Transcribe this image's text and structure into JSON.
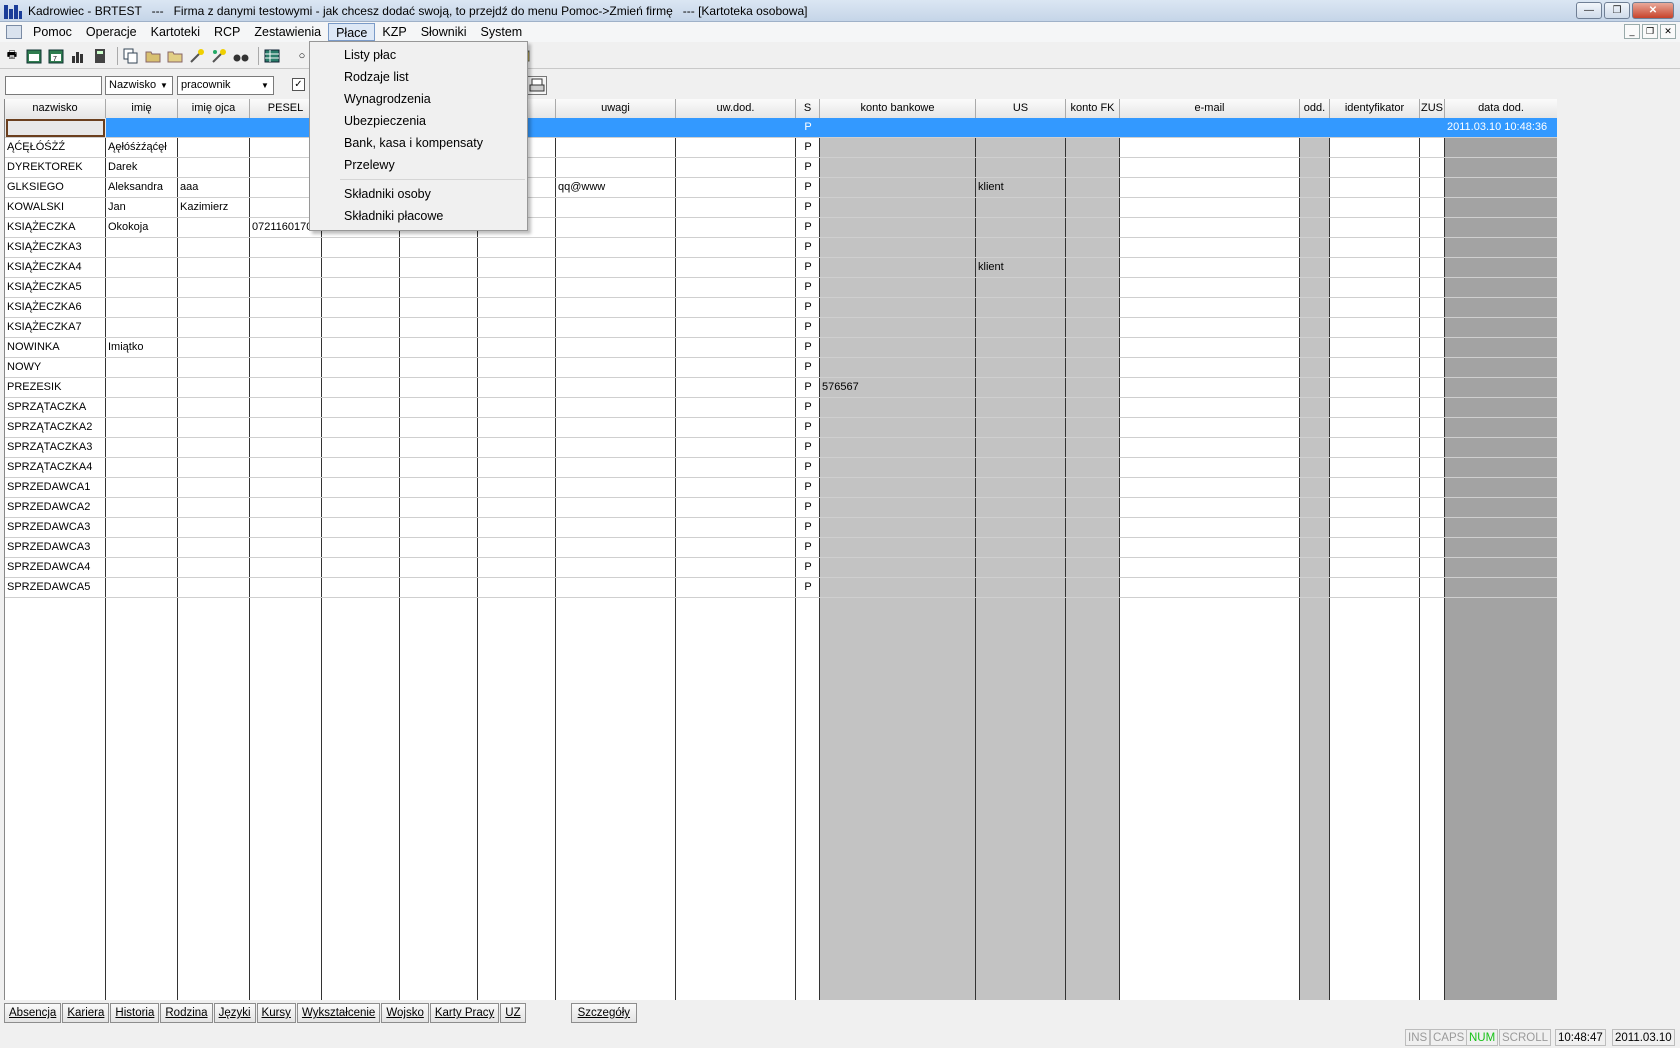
{
  "window": {
    "title": "Kadrowiec - BRTEST   ---   Firma z danymi testowymi - jak chcesz dodać swoją, to przejdź do menu Pomoc->Zmień firmę   --- [Kartoteka osobowa]"
  },
  "menu": [
    "Pomoc",
    "Operacje",
    "Kartoteki",
    "RCP",
    "Zestawienia",
    "Płace",
    "KZP",
    "Słowniki",
    "System"
  ],
  "active_menu": "Płace",
  "dropdown": {
    "group1": [
      "Listy płac",
      "Rodzaje list",
      "Wynagrodzenia",
      "Ubezpieczenia",
      "Bank, kasa i kompensaty",
      "Przelewy"
    ],
    "group2": [
      "Składniki osoby",
      "Składniki płacowe"
    ]
  },
  "filter": {
    "search_value": "",
    "field_combo": "Nazwisko",
    "type_combo": "pracownik"
  },
  "columns": [
    "nazwisko",
    "imię",
    "imię ojca",
    "PESEL",
    "",
    "",
    "...cz.",
    "uwagi",
    "uw.dod.",
    "S",
    "konto bankowe",
    "US",
    "konto FK",
    "e-mail",
    "odd.",
    "identyfikator",
    "ZUS",
    "data dod."
  ],
  "rows": [
    {
      "nazwisko": "",
      "imie": "",
      "imie_ojca": "",
      "pesel": "",
      "uwagi": "",
      "s": "P",
      "konto": "",
      "us": "",
      "data": "2011.03.10 10:48:36"
    },
    {
      "nazwisko": "ĄĆĘŁÓŚŻŹ",
      "imie": "Ąęłóśżźąćęł",
      "imie_ojca": "",
      "pesel": "",
      "uwagi": "",
      "s": "P",
      "konto": "",
      "us": "",
      "data": ""
    },
    {
      "nazwisko": "DYREKTOREK",
      "imie": "Darek",
      "imie_ojca": "",
      "pesel": "",
      "uwagi": "",
      "s": "P",
      "konto": "",
      "us": "",
      "data": ""
    },
    {
      "nazwisko": "GLKSIEGO",
      "imie": "Aleksandra",
      "imie_ojca": "aaa",
      "pesel": "",
      "uwagi": "qq@www",
      "s": "P",
      "konto": "",
      "us": "klient",
      "data": ""
    },
    {
      "nazwisko": "KOWALSKI",
      "imie": "Jan",
      "imie_ojca": "Kazimierz",
      "pesel": "",
      "uwagi": "",
      "s": "P",
      "konto": "",
      "us": "",
      "data": ""
    },
    {
      "nazwisko": "KSIĄŻECZKA",
      "imie": "Okokoja",
      "imie_ojca": "",
      "pesel": "07211601703",
      "uwagi": "",
      "s": "P",
      "konto": "",
      "us": "",
      "data": ""
    },
    {
      "nazwisko": "KSIĄŻECZKA3",
      "imie": "",
      "imie_ojca": "",
      "pesel": "",
      "uwagi": "",
      "s": "P",
      "konto": "",
      "us": "",
      "data": ""
    },
    {
      "nazwisko": "KSIĄŻECZKA4",
      "imie": "",
      "imie_ojca": "",
      "pesel": "",
      "uwagi": "",
      "s": "P",
      "konto": "",
      "us": "klient",
      "data": ""
    },
    {
      "nazwisko": "KSIĄŻECZKA5",
      "imie": "",
      "imie_ojca": "",
      "pesel": "",
      "uwagi": "",
      "s": "P",
      "konto": "",
      "us": "",
      "data": ""
    },
    {
      "nazwisko": "KSIĄŻECZKA6",
      "imie": "",
      "imie_ojca": "",
      "pesel": "",
      "uwagi": "",
      "s": "P",
      "konto": "",
      "us": "",
      "data": ""
    },
    {
      "nazwisko": "KSIĄŻECZKA7",
      "imie": "",
      "imie_ojca": "",
      "pesel": "",
      "uwagi": "",
      "s": "P",
      "konto": "",
      "us": "",
      "data": ""
    },
    {
      "nazwisko": "NOWINKA",
      "imie": "Imiątko",
      "imie_ojca": "",
      "pesel": "",
      "uwagi": "",
      "s": "P",
      "konto": "",
      "us": "",
      "data": ""
    },
    {
      "nazwisko": "NOWY",
      "imie": "",
      "imie_ojca": "",
      "pesel": "",
      "uwagi": "",
      "s": "P",
      "konto": "",
      "us": "",
      "data": ""
    },
    {
      "nazwisko": "PREZESIK",
      "imie": "",
      "imie_ojca": "",
      "pesel": "",
      "uwagi": "",
      "s": "P",
      "konto": "576567",
      "us": "",
      "data": ""
    },
    {
      "nazwisko": "SPRZĄTACZKA",
      "imie": "",
      "imie_ojca": "",
      "pesel": "",
      "uwagi": "",
      "s": "P",
      "konto": "",
      "us": "",
      "data": ""
    },
    {
      "nazwisko": "SPRZĄTACZKA2",
      "imie": "",
      "imie_ojca": "",
      "pesel": "",
      "uwagi": "",
      "s": "P",
      "konto": "",
      "us": "",
      "data": ""
    },
    {
      "nazwisko": "SPRZĄTACZKA3",
      "imie": "",
      "imie_ojca": "",
      "pesel": "",
      "uwagi": "",
      "s": "P",
      "konto": "",
      "us": "",
      "data": ""
    },
    {
      "nazwisko": "SPRZĄTACZKA4",
      "imie": "",
      "imie_ojca": "",
      "pesel": "",
      "uwagi": "",
      "s": "P",
      "konto": "",
      "us": "",
      "data": ""
    },
    {
      "nazwisko": "SPRZEDAWCA1",
      "imie": "",
      "imie_ojca": "",
      "pesel": "",
      "uwagi": "",
      "s": "P",
      "konto": "",
      "us": "",
      "data": ""
    },
    {
      "nazwisko": "SPRZEDAWCA2",
      "imie": "",
      "imie_ojca": "",
      "pesel": "",
      "uwagi": "",
      "s": "P",
      "konto": "",
      "us": "",
      "data": ""
    },
    {
      "nazwisko": "SPRZEDAWCA3",
      "imie": "",
      "imie_ojca": "",
      "pesel": "",
      "uwagi": "",
      "s": "P",
      "konto": "",
      "us": "",
      "data": ""
    },
    {
      "nazwisko": "SPRZEDAWCA3",
      "imie": "",
      "imie_ojca": "",
      "pesel": "",
      "uwagi": "",
      "s": "P",
      "konto": "",
      "us": "",
      "data": ""
    },
    {
      "nazwisko": "SPRZEDAWCA4",
      "imie": "",
      "imie_ojca": "",
      "pesel": "",
      "uwagi": "",
      "s": "P",
      "konto": "",
      "us": "",
      "data": ""
    },
    {
      "nazwisko": "SPRZEDAWCA5",
      "imie": "",
      "imie_ojca": "",
      "pesel": "",
      "uwagi": "",
      "s": "P",
      "konto": "",
      "us": "",
      "data": ""
    }
  ],
  "tabs": [
    "Absencja",
    "Kariera",
    "Historia",
    "Rodzina",
    "Języki",
    "Kursy",
    "Wykształcenie",
    "Wojsko",
    "Karty Pracy",
    "UZ",
    "Szczegóły"
  ],
  "status": {
    "ins": "INS",
    "caps": "CAPS",
    "num": "NUM",
    "scroll": "SCROLL",
    "time": "10:48:47",
    "date": "2011.03.10"
  },
  "toolbar_icons": [
    "printer-icon",
    "calendar-icon",
    "calendar-edit-icon",
    "chart-icon",
    "calculator-icon",
    "copy-icon",
    "folder-open-icon",
    "folder-icon",
    "wand-icon",
    "wand2-icon",
    "binoculars-icon",
    "table-icon",
    "help-icon",
    "envelope-icon",
    "print-preview-icon"
  ],
  "colors": {
    "selection": "#3399ff",
    "gray_column": "#c3c3c3",
    "dark_gray_column": "#a3a3a3"
  }
}
